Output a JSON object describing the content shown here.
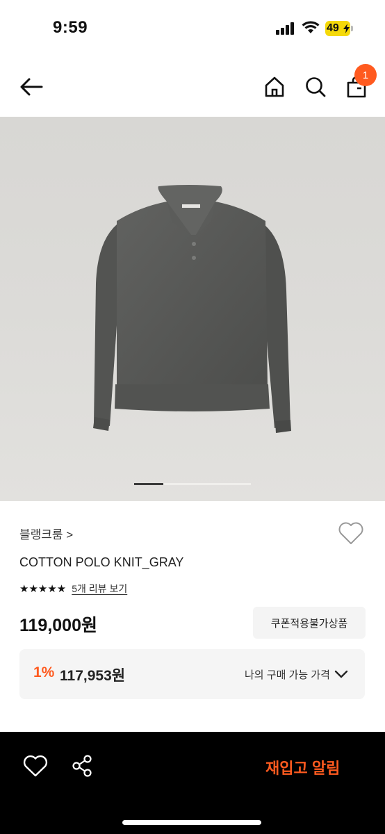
{
  "status": {
    "time": "9:59",
    "battery": "49"
  },
  "nav": {
    "cart_badge": "1"
  },
  "icons": {
    "back": "arrow-left-icon",
    "home": "home-icon",
    "search": "search-icon",
    "bag": "shopping-bag-icon",
    "like": "heart-icon",
    "share": "share-icon",
    "chevron": "chevron-down-icon"
  },
  "carousel": {
    "total_slides": 4,
    "current_slide": 1
  },
  "product": {
    "brand": "블랭크룸 >",
    "title": "COTTON POLO KNIT_GRAY",
    "stars": "★★★★★",
    "review_link": "5개 리뷰 보기",
    "price": "119,000원",
    "coupon_label": "쿠폰적용불가상품",
    "discount_rate": "1%",
    "my_price": "117,953원",
    "my_price_label": "나의 구매 가능 가격"
  },
  "bottom": {
    "restock_label": "재입고 알림"
  },
  "colors": {
    "accent": "#ff5a1f",
    "bottom_bar": "#000000",
    "garment": "#5a5b59"
  }
}
